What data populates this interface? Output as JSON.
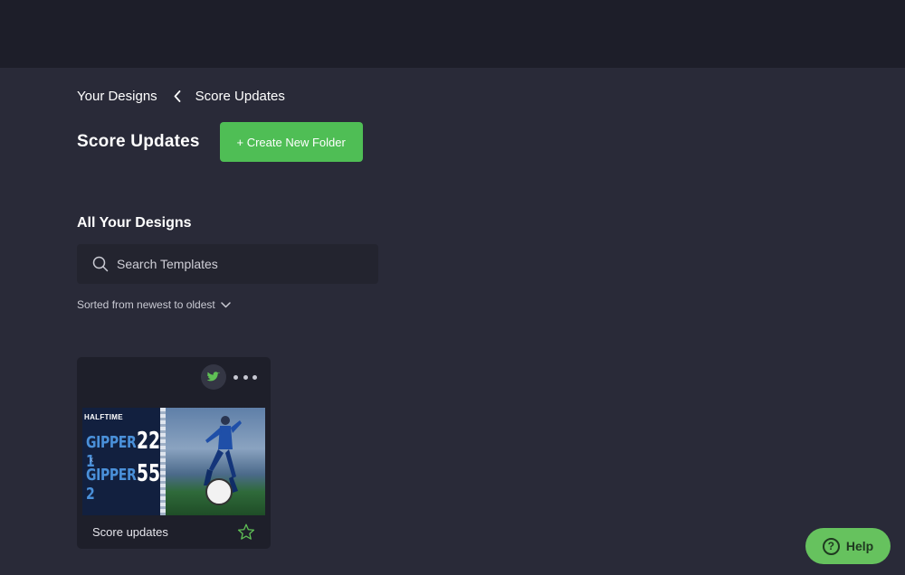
{
  "breadcrumb": {
    "root": "Your Designs",
    "current": "Score Updates"
  },
  "page": {
    "title": "Score Updates",
    "create_folder_label": "+ Create New Folder"
  },
  "designs": {
    "section_title": "All Your Designs",
    "search_placeholder": "Search Templates",
    "sort_label": "Sorted from newest to oldest"
  },
  "cards": [
    {
      "name": "Score updates",
      "platform_icon": "twitter-icon",
      "thumbnail": {
        "header": "HALFTIME",
        "team1": "GIPPER 1",
        "score1": "22",
        "vs": "x",
        "team2": "GIPPER 2",
        "score2": "55"
      }
    }
  ],
  "help": {
    "label": "Help",
    "icon_glyph": "?"
  },
  "colors": {
    "background": "#292a38",
    "topbar": "#1d1e29",
    "accent_green": "#4fbe55",
    "help_green": "#66c25e"
  }
}
